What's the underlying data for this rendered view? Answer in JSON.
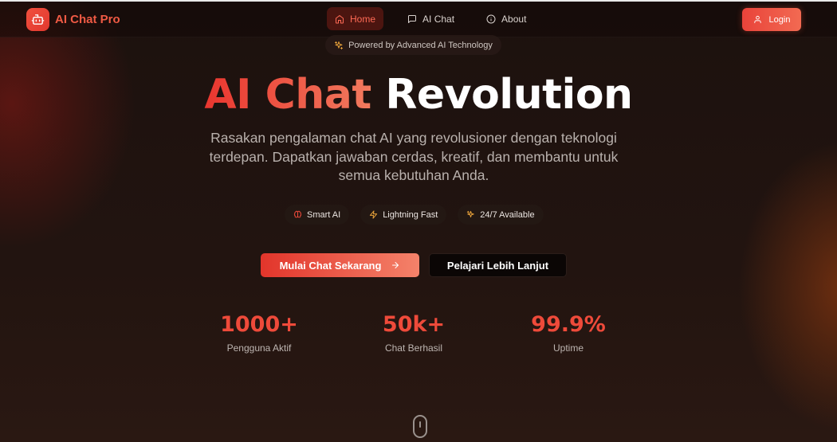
{
  "nav": {
    "brand": "AI Chat Pro",
    "items": [
      {
        "label": "Home",
        "icon": "home-icon",
        "active": true
      },
      {
        "label": "AI Chat",
        "icon": "message-square-icon",
        "active": false
      },
      {
        "label": "About",
        "icon": "info-icon",
        "active": false
      }
    ],
    "login_label": "Login"
  },
  "hero": {
    "badge": "Powered by Advanced AI Technology",
    "title_accent": "AI Chat",
    "title_rest": "Revolution",
    "subtitle": "Rasakan pengalaman chat AI yang revolusioner dengan teknologi terdepan. Dapatkan jawaban cerdas, kreatif, dan membantu untuk semua kebutuhan Anda.",
    "features": [
      {
        "label": "Smart AI",
        "icon": "brain-icon"
      },
      {
        "label": "Lightning Fast",
        "icon": "zap-icon"
      },
      {
        "label": "24/7 Available",
        "icon": "sparkles-icon"
      }
    ],
    "cta_primary": "Mulai Chat Sekarang",
    "cta_secondary": "Pelajari Lebih Lanjut"
  },
  "stats": [
    {
      "value": "1000+",
      "label": "Pengguna Aktif"
    },
    {
      "value": "50k+",
      "label": "Chat Berhasil"
    },
    {
      "value": "99.9%",
      "label": "Uptime"
    }
  ],
  "colors": {
    "accent": "#ee4a3a",
    "accent_light": "#f27a5e",
    "background": "#1c110e"
  }
}
